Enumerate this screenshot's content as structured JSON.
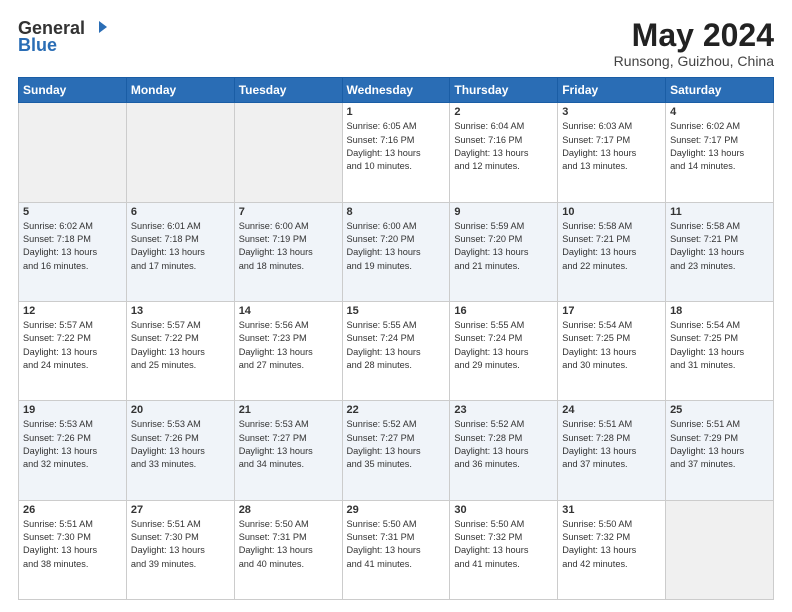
{
  "logo": {
    "general": "General",
    "blue": "Blue"
  },
  "header": {
    "month": "May 2024",
    "location": "Runsong, Guizhou, China"
  },
  "days_of_week": [
    "Sunday",
    "Monday",
    "Tuesday",
    "Wednesday",
    "Thursday",
    "Friday",
    "Saturday"
  ],
  "weeks": [
    [
      {
        "day": "",
        "info": ""
      },
      {
        "day": "",
        "info": ""
      },
      {
        "day": "",
        "info": ""
      },
      {
        "day": "1",
        "info": "Sunrise: 6:05 AM\nSunset: 7:16 PM\nDaylight: 13 hours\nand 10 minutes."
      },
      {
        "day": "2",
        "info": "Sunrise: 6:04 AM\nSunset: 7:16 PM\nDaylight: 13 hours\nand 12 minutes."
      },
      {
        "day": "3",
        "info": "Sunrise: 6:03 AM\nSunset: 7:17 PM\nDaylight: 13 hours\nand 13 minutes."
      },
      {
        "day": "4",
        "info": "Sunrise: 6:02 AM\nSunset: 7:17 PM\nDaylight: 13 hours\nand 14 minutes."
      }
    ],
    [
      {
        "day": "5",
        "info": "Sunrise: 6:02 AM\nSunset: 7:18 PM\nDaylight: 13 hours\nand 16 minutes."
      },
      {
        "day": "6",
        "info": "Sunrise: 6:01 AM\nSunset: 7:18 PM\nDaylight: 13 hours\nand 17 minutes."
      },
      {
        "day": "7",
        "info": "Sunrise: 6:00 AM\nSunset: 7:19 PM\nDaylight: 13 hours\nand 18 minutes."
      },
      {
        "day": "8",
        "info": "Sunrise: 6:00 AM\nSunset: 7:20 PM\nDaylight: 13 hours\nand 19 minutes."
      },
      {
        "day": "9",
        "info": "Sunrise: 5:59 AM\nSunset: 7:20 PM\nDaylight: 13 hours\nand 21 minutes."
      },
      {
        "day": "10",
        "info": "Sunrise: 5:58 AM\nSunset: 7:21 PM\nDaylight: 13 hours\nand 22 minutes."
      },
      {
        "day": "11",
        "info": "Sunrise: 5:58 AM\nSunset: 7:21 PM\nDaylight: 13 hours\nand 23 minutes."
      }
    ],
    [
      {
        "day": "12",
        "info": "Sunrise: 5:57 AM\nSunset: 7:22 PM\nDaylight: 13 hours\nand 24 minutes."
      },
      {
        "day": "13",
        "info": "Sunrise: 5:57 AM\nSunset: 7:22 PM\nDaylight: 13 hours\nand 25 minutes."
      },
      {
        "day": "14",
        "info": "Sunrise: 5:56 AM\nSunset: 7:23 PM\nDaylight: 13 hours\nand 27 minutes."
      },
      {
        "day": "15",
        "info": "Sunrise: 5:55 AM\nSunset: 7:24 PM\nDaylight: 13 hours\nand 28 minutes."
      },
      {
        "day": "16",
        "info": "Sunrise: 5:55 AM\nSunset: 7:24 PM\nDaylight: 13 hours\nand 29 minutes."
      },
      {
        "day": "17",
        "info": "Sunrise: 5:54 AM\nSunset: 7:25 PM\nDaylight: 13 hours\nand 30 minutes."
      },
      {
        "day": "18",
        "info": "Sunrise: 5:54 AM\nSunset: 7:25 PM\nDaylight: 13 hours\nand 31 minutes."
      }
    ],
    [
      {
        "day": "19",
        "info": "Sunrise: 5:53 AM\nSunset: 7:26 PM\nDaylight: 13 hours\nand 32 minutes."
      },
      {
        "day": "20",
        "info": "Sunrise: 5:53 AM\nSunset: 7:26 PM\nDaylight: 13 hours\nand 33 minutes."
      },
      {
        "day": "21",
        "info": "Sunrise: 5:53 AM\nSunset: 7:27 PM\nDaylight: 13 hours\nand 34 minutes."
      },
      {
        "day": "22",
        "info": "Sunrise: 5:52 AM\nSunset: 7:27 PM\nDaylight: 13 hours\nand 35 minutes."
      },
      {
        "day": "23",
        "info": "Sunrise: 5:52 AM\nSunset: 7:28 PM\nDaylight: 13 hours\nand 36 minutes."
      },
      {
        "day": "24",
        "info": "Sunrise: 5:51 AM\nSunset: 7:28 PM\nDaylight: 13 hours\nand 37 minutes."
      },
      {
        "day": "25",
        "info": "Sunrise: 5:51 AM\nSunset: 7:29 PM\nDaylight: 13 hours\nand 37 minutes."
      }
    ],
    [
      {
        "day": "26",
        "info": "Sunrise: 5:51 AM\nSunset: 7:30 PM\nDaylight: 13 hours\nand 38 minutes."
      },
      {
        "day": "27",
        "info": "Sunrise: 5:51 AM\nSunset: 7:30 PM\nDaylight: 13 hours\nand 39 minutes."
      },
      {
        "day": "28",
        "info": "Sunrise: 5:50 AM\nSunset: 7:31 PM\nDaylight: 13 hours\nand 40 minutes."
      },
      {
        "day": "29",
        "info": "Sunrise: 5:50 AM\nSunset: 7:31 PM\nDaylight: 13 hours\nand 41 minutes."
      },
      {
        "day": "30",
        "info": "Sunrise: 5:50 AM\nSunset: 7:32 PM\nDaylight: 13 hours\nand 41 minutes."
      },
      {
        "day": "31",
        "info": "Sunrise: 5:50 AM\nSunset: 7:32 PM\nDaylight: 13 hours\nand 42 minutes."
      },
      {
        "day": "",
        "info": ""
      }
    ]
  ]
}
